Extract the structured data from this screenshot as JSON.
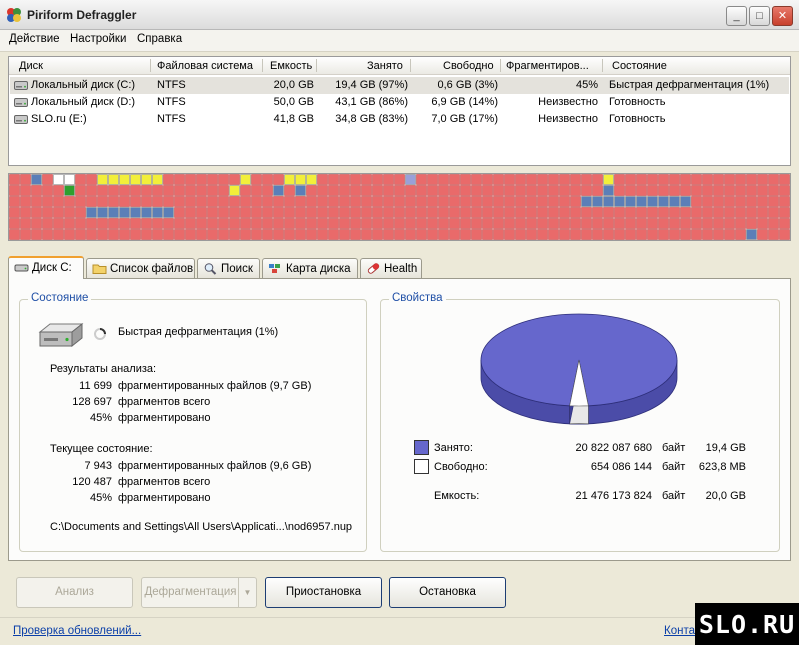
{
  "window": {
    "title": "Piriform Defraggler"
  },
  "titlebar": {
    "minimize": "_",
    "maximize": "□",
    "close": "✕"
  },
  "menu": [
    "Действие",
    "Настройки",
    "Справка"
  ],
  "drive_list": {
    "columns": [
      "Диск",
      "Файловая система",
      "Емкость",
      "Занято",
      "Свободно",
      "Фрагментиров...",
      "Состояние"
    ],
    "rows": [
      {
        "name": "Локальный диск (C:)",
        "fs": "NTFS",
        "capacity": "20,0 GB",
        "used": "19,4 GB (97%)",
        "free": "0,6 GB (3%)",
        "fragmented": "45%",
        "state": "Быстрая дефрагментация (1%)",
        "selected": true
      },
      {
        "name": "Локальный диск (D:)",
        "fs": "NTFS",
        "capacity": "50,0 GB",
        "used": "43,1 GB (86%)",
        "free": "6,9 GB (14%)",
        "fragmented": "Неизвестно",
        "state": "Готовность",
        "selected": false
      },
      {
        "name": "SLO.ru (E:)",
        "fs": "NTFS",
        "capacity": "41,8 GB",
        "used": "34,8 GB (83%)",
        "free": "7,0 GB (17%)",
        "fragmented": "Неизвестно",
        "state": "Готовность",
        "selected": false
      }
    ]
  },
  "diskmap": {
    "colors": {
      "fragmented": "#e96a6a",
      "contiguous": "#5b7fb8",
      "free": "#ffffff",
      "system": "#f2ef3a",
      "mft": "#2ea02e",
      "pending": "#9aa0d8"
    }
  },
  "tabs": [
    {
      "label": "Диск C:",
      "icon": "hdd-icon",
      "active": true
    },
    {
      "label": "Список файлов",
      "icon": "folder-icon",
      "active": false
    },
    {
      "label": "Поиск",
      "icon": "magnifier-icon",
      "active": false
    },
    {
      "label": "Карта диска",
      "icon": "disk-map-icon",
      "active": false
    },
    {
      "label": "Health",
      "icon": "health-pill-icon",
      "active": false
    }
  ],
  "state_group": {
    "title": "Состояние",
    "status": "Быстрая дефрагментация (1%)",
    "analysis": {
      "heading": "Результаты анализа:",
      "rows": [
        {
          "value": "11 699",
          "label": "фрагментированных файлов (9,7 GB)"
        },
        {
          "value": "128 697",
          "label": "фрагментов всего"
        },
        {
          "value": "45%",
          "label": "фрагментировано"
        }
      ]
    },
    "current": {
      "heading": "Текущее состояние:",
      "rows": [
        {
          "value": "7 943",
          "label": "фрагментированных файлов (9,6 GB)"
        },
        {
          "value": "120 487",
          "label": "фрагментов всего"
        },
        {
          "value": "45%",
          "label": "фрагментировано"
        }
      ]
    },
    "current_file": "C:\\Documents and Settings\\All Users\\Applicati...\\nod6957.nup"
  },
  "properties_group": {
    "title": "Свойства",
    "pie": {
      "used_fraction": 0.9695,
      "used_color": "#6667cc",
      "free_color": "#ffffff"
    },
    "used": {
      "label": "Занято:",
      "bytes": "20 822 087 680",
      "unit": "байт",
      "size": "19,4 GB"
    },
    "free": {
      "label": "Свободно:",
      "bytes": "654 086 144",
      "unit": "байт",
      "size": "623,8 MB"
    },
    "capacity": {
      "label": "Емкость:",
      "bytes": "21 476 173 824",
      "unit": "байт",
      "size": "20,0 GB"
    }
  },
  "buttons": {
    "analyze": "Анализ",
    "defrag": "Дефрагментация",
    "pause": "Приостановка",
    "stop": "Остановка"
  },
  "statusbar": {
    "update_link": "Проверка обновлений...",
    "contact_link": "Конта"
  },
  "watermark": "SLO.RU"
}
